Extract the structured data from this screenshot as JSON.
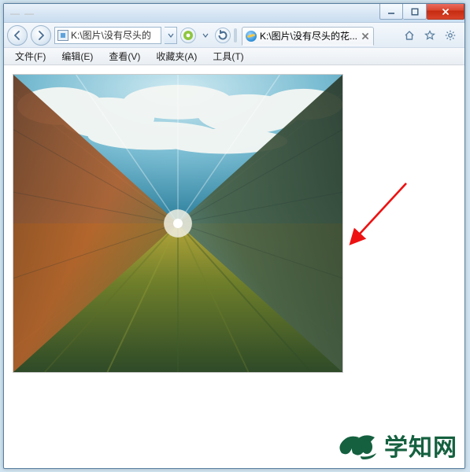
{
  "titlebar": {
    "left_hint_1": "—",
    "left_hint_2": "—"
  },
  "window_controls": {
    "minimize": "minimize",
    "maximize": "maximize",
    "close": "close"
  },
  "navbar": {
    "address_text": "K:\\图片\\没有尽头的"
  },
  "tab": {
    "title": "K:\\图片\\没有尽头的花...",
    "close": "×"
  },
  "menu": {
    "file": "文件(F)",
    "edit": "编辑(E)",
    "view": "查看(V)",
    "favorites": "收藏夹(A)",
    "tools": "工具(T)"
  },
  "watermark": {
    "text": "学知网"
  }
}
